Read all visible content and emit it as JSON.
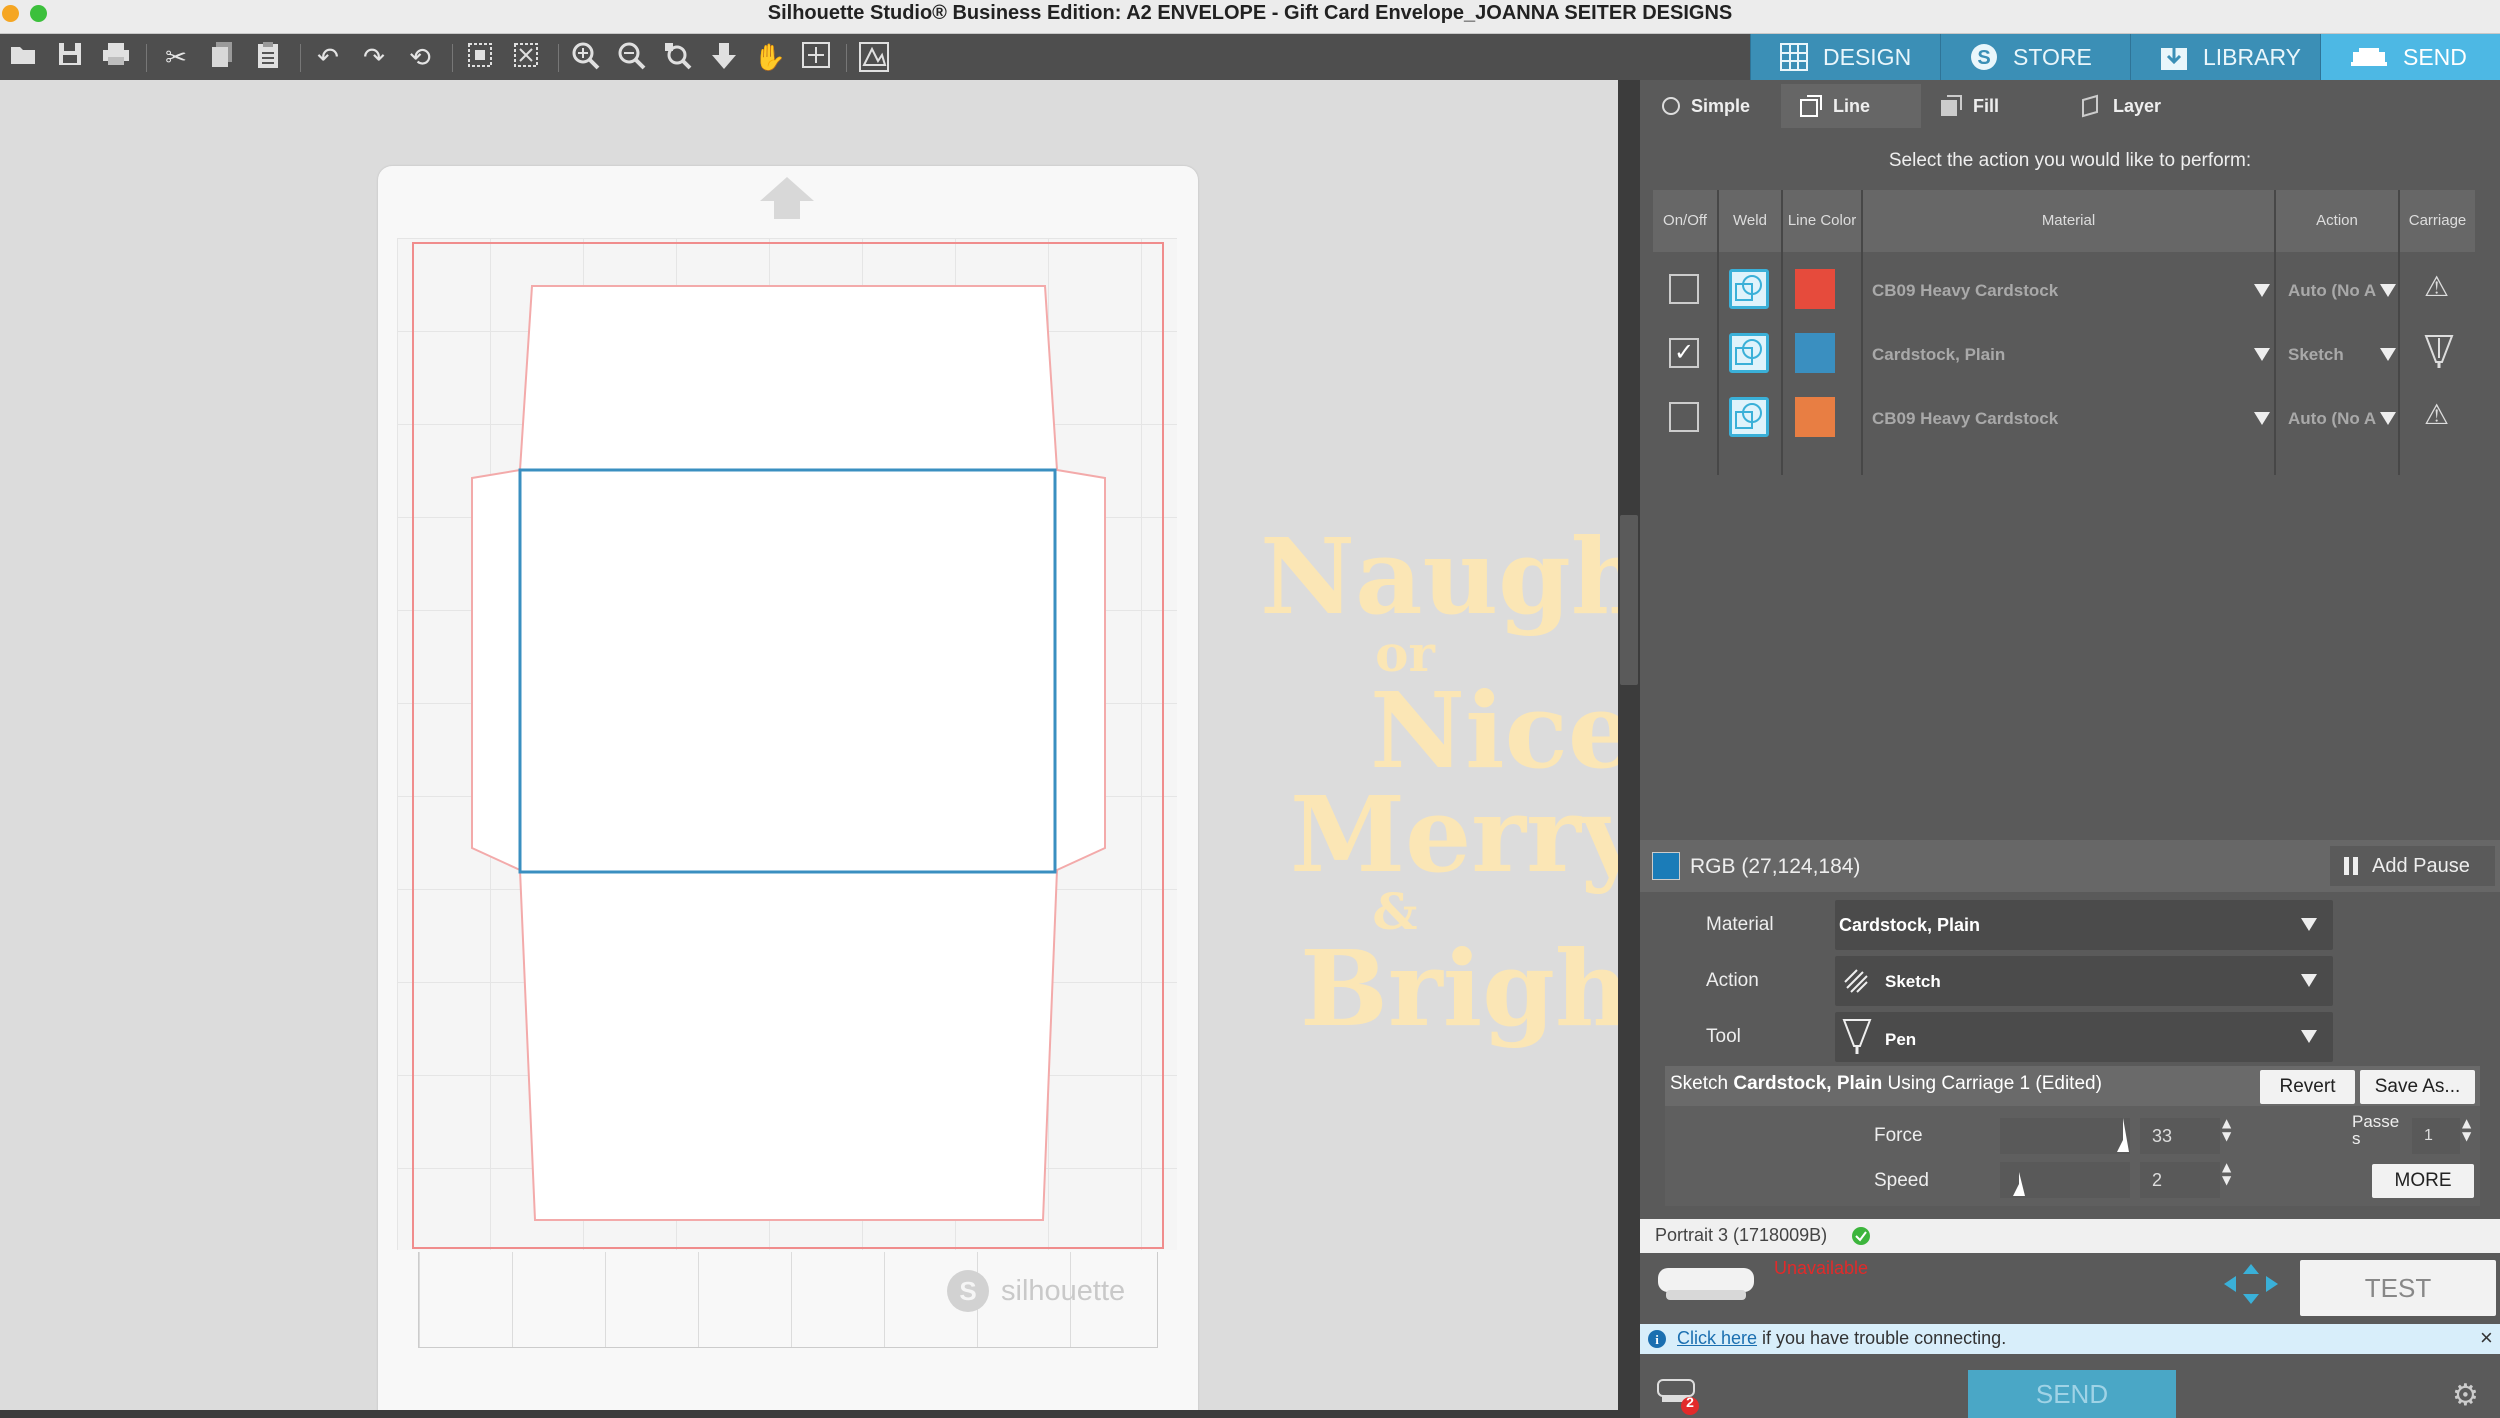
{
  "window": {
    "title": "Silhouette Studio® Business Edition: A2 ENVELOPE - Gift Card Envelope_JOANNA SEITER DESIGNS"
  },
  "toolbar": {
    "icons": [
      "open-folder-icon",
      "save-icon",
      "print-icon",
      "cut-icon",
      "copy-icon",
      "paste-icon",
      "undo-icon",
      "redo-icon",
      "redraw-icon",
      "select-all-icon",
      "deselect-icon",
      "zoom-in-icon",
      "zoom-out-icon",
      "zoom-selected-icon",
      "pan-down-icon",
      "hand-icon",
      "fit-page-icon",
      "trace-icon"
    ]
  },
  "nav_tabs": [
    {
      "label": "DESIGN",
      "icon": "grid-icon",
      "active": false
    },
    {
      "label": "STORE",
      "icon": "store-s-icon",
      "active": false
    },
    {
      "label": "LIBRARY",
      "icon": "library-download-icon",
      "active": false
    },
    {
      "label": "SEND",
      "icon": "cutter-icon",
      "active": true
    }
  ],
  "canvas": {
    "brand": "silhouette",
    "artwork_text": [
      "Naugh",
      "or",
      "Nice",
      "Merry",
      "&",
      "Brigh"
    ],
    "colors": {
      "cut_red": "#f2a3a3",
      "selected_blue": "#3a8fc0",
      "artwork_yellow": "#fbe6b5"
    }
  },
  "send_panel": {
    "sub_tabs": [
      {
        "label": "Simple",
        "icon": "radio-icon"
      },
      {
        "label": "Line",
        "icon": "line-icon",
        "active": true
      },
      {
        "label": "Fill",
        "icon": "fill-icon"
      },
      {
        "label": "Layer",
        "icon": "layer-icon"
      }
    ],
    "instructions": "Select the action you would like to perform:",
    "table": {
      "headers": {
        "onoff": "On/Off",
        "weld": "Weld",
        "line_color": "Line Color",
        "material": "Material",
        "action": "Action",
        "carriage": "Carriage"
      },
      "rows": [
        {
          "checked": false,
          "color": "#e64b3c",
          "material": "CB09 Heavy Cardstock",
          "action": "Auto (No A",
          "carriage": "warning-icon"
        },
        {
          "checked": true,
          "color": "#3a8fc0",
          "material": "Cardstock, Plain",
          "action": "Sketch",
          "carriage": "pen-icon"
        },
        {
          "checked": false,
          "color": "#e87e43",
          "material": "CB09 Heavy Cardstock",
          "action": "Auto (No A",
          "carriage": "warning-icon"
        }
      ]
    },
    "rgb_label": "RGB (27,124,184)",
    "add_pause": "Add Pause",
    "material_label": "Material",
    "material_value": "Cardstock, Plain",
    "action_label": "Action",
    "action_value": "Sketch",
    "tool_label": "Tool",
    "tool_value": "Pen",
    "summary_prefix": "Sketch",
    "summary_material": "Cardstock, Plain",
    "summary_suffix": "Using Carriage 1 (Edited)",
    "revert": "Revert",
    "save_as": "Save As...",
    "force_label": "Force",
    "force_value": "33",
    "speed_label": "Speed",
    "speed_value": "2",
    "passes_label": "Passe s",
    "passes_value": "1",
    "more": "MORE",
    "device": "Portrait 3 (1718009B)",
    "status": "Unavailable",
    "test": "TEST",
    "info_link": "Click here",
    "info_text": " if you have trouble connecting.",
    "send": "SEND",
    "queue_count": "2"
  }
}
